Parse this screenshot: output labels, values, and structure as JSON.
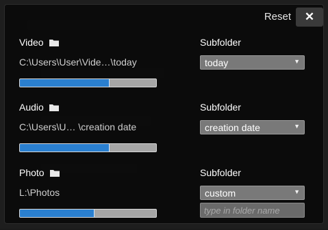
{
  "dialog": {
    "reset_label": "Reset",
    "close_glyph": "✕"
  },
  "sections": [
    {
      "label": "Video",
      "icon": "folder-icon",
      "path": "C:\\Users\\User\\Vide…\\today",
      "progress": 0.66,
      "subfolder_label": "Subfolder",
      "subfolder_value": "today"
    },
    {
      "label": "Audio",
      "icon": "folder-icon",
      "path": "C:\\Users\\U… \\creation date",
      "progress": 0.66,
      "subfolder_label": "Subfolder",
      "subfolder_value": "creation date"
    },
    {
      "label": "Photo",
      "icon": "folder-icon",
      "path": "L:\\Photos",
      "progress": 0.55,
      "subfolder_label": "Subfolder",
      "subfolder_value": "custom",
      "custom_folder_placeholder": "type in folder name"
    }
  ],
  "dropdown_arrow": "▼",
  "colors": {
    "accent_progress": "#2a7fcf",
    "dialog_background": "#0a0a0a",
    "dropdown_background": "#797979"
  }
}
